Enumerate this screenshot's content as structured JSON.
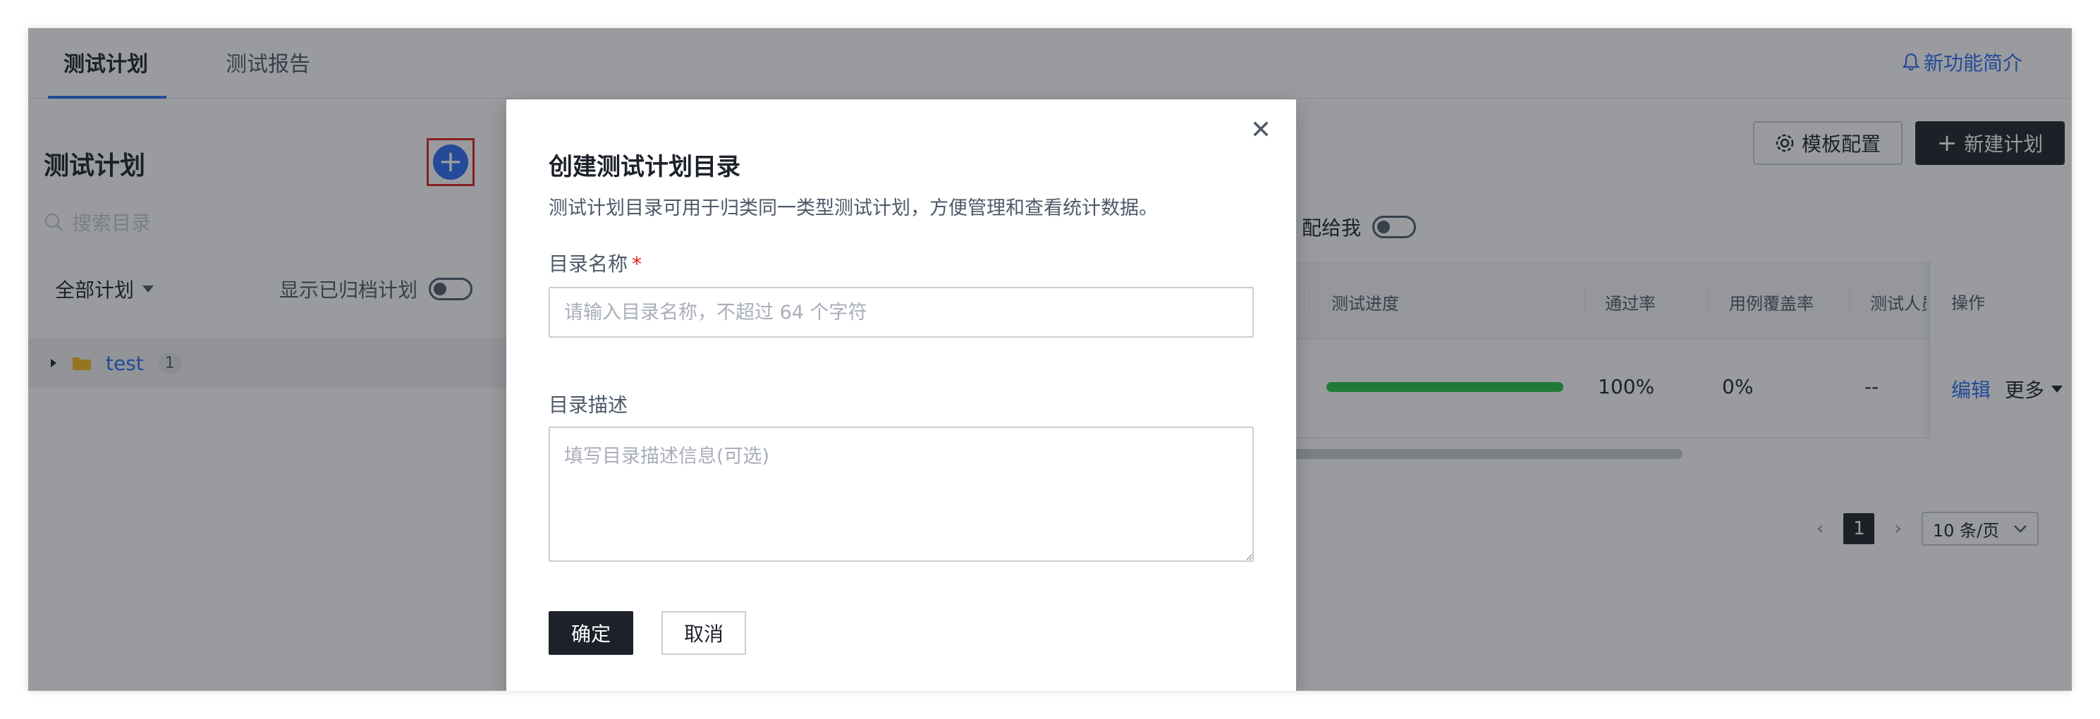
{
  "tabs": [
    {
      "label": "测试计划",
      "active": true
    },
    {
      "label": "测试报告",
      "active": false
    }
  ],
  "whats_new": {
    "label": "新功能简介",
    "icon": "bell-icon"
  },
  "left_panel": {
    "title": "测试计划",
    "add_icon": "plus-circle-icon",
    "search_placeholder": "搜索目录",
    "filter_label": "全部计划",
    "show_archived_label": "显示已归档计划",
    "tree": [
      {
        "label": "test",
        "count": "1",
        "icon": "folder-icon"
      }
    ]
  },
  "right_panel": {
    "template_button": "模板配置",
    "new_plan_button": "新建计划",
    "assigned_to_me": "配给我",
    "columns": [
      "测试进度",
      "通过率",
      "用例覆盖率",
      "测试人员",
      "操作"
    ],
    "rows": [
      {
        "progress": 1.0,
        "pass_rate": "100%",
        "coverage": "0%",
        "tester": "--",
        "edit": "编辑",
        "more": "更多"
      }
    ],
    "pagination": {
      "current": "1",
      "page_size": "10 条/页"
    }
  },
  "modal": {
    "title": "创建测试计划目录",
    "description": "测试计划目录可用于归类同一类型测试计划，方便管理和查看统计数据。",
    "name_label": "目录名称",
    "name_required": "*",
    "name_placeholder": "请输入目录名称，不超过 64 个字符",
    "desc_label": "目录描述",
    "desc_placeholder": "填写目录描述信息(可选)",
    "confirm": "确定",
    "cancel": "取消"
  },
  "colors": {
    "primary": "#2b6cf6",
    "dark_button": "#1d2129",
    "progress_green": "#23c343",
    "highlight_border": "#e02020"
  }
}
